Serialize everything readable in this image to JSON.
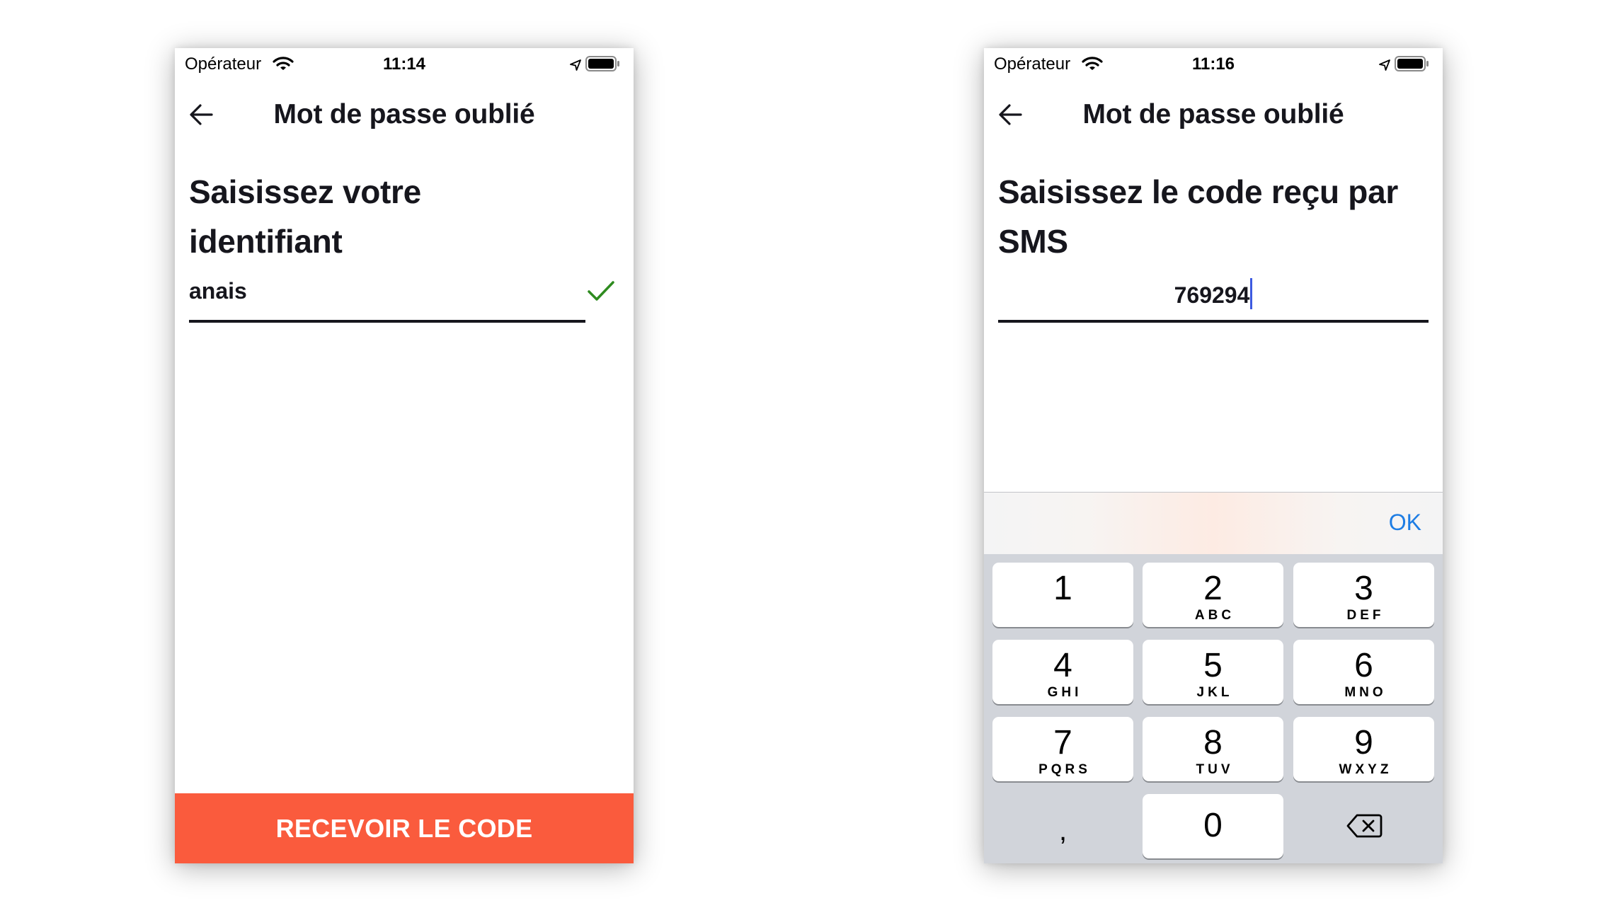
{
  "screen1": {
    "status": {
      "carrier": "Opérateur",
      "time": "11:14"
    },
    "nav": {
      "title": "Mot de passe oublié"
    },
    "heading_line1": "Saisissez votre",
    "heading_line2": "identifiant",
    "field": {
      "value": "anais",
      "valid": true
    },
    "cta_label": "RECEVOIR LE CODE"
  },
  "screen2": {
    "status": {
      "carrier": "Opérateur",
      "time": "11:16"
    },
    "nav": {
      "title": "Mot de passe oublié"
    },
    "heading_line1": "Saisissez le code reçu par",
    "heading_line2": "SMS",
    "field": {
      "value": "769294"
    },
    "keyboard": {
      "done_label": "OK",
      "keys": [
        {
          "digit": "1",
          "letters": ""
        },
        {
          "digit": "2",
          "letters": "ABC"
        },
        {
          "digit": "3",
          "letters": "DEF"
        },
        {
          "digit": "4",
          "letters": "GHI"
        },
        {
          "digit": "5",
          "letters": "JKL"
        },
        {
          "digit": "6",
          "letters": "MNO"
        },
        {
          "digit": "7",
          "letters": "PQRS"
        },
        {
          "digit": "8",
          "letters": "TUV"
        },
        {
          "digit": "9",
          "letters": "WXYZ"
        }
      ],
      "comma": ",",
      "zero": "0"
    }
  },
  "colors": {
    "accent": "#fa5b3d",
    "text": "#16161d",
    "check": "#2e8b1f",
    "link": "#1e7de4",
    "caret": "#3d5ae0",
    "keyboard_bg": "#d1d4da"
  },
  "icons": {
    "wifi": "wifi-icon",
    "location": "location-arrow-icon",
    "battery": "battery-icon",
    "back": "back-arrow-icon",
    "check": "checkmark-icon",
    "delete": "backspace-icon"
  }
}
